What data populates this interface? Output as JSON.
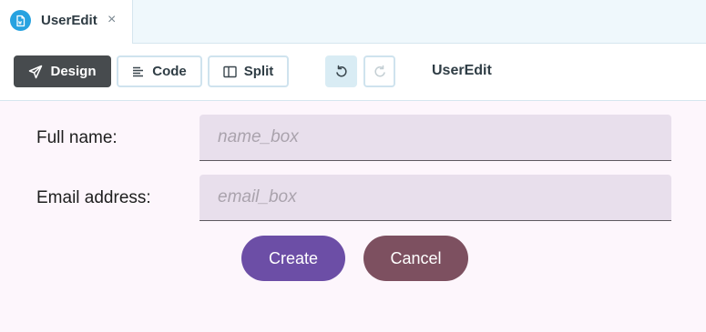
{
  "tab": {
    "title": "UserEdit",
    "close": "×"
  },
  "toolbar": {
    "design_label": "Design",
    "code_label": "Code",
    "split_label": "Split",
    "doc_title": "UserEdit",
    "icons": {
      "design": "paper-plane-icon",
      "code": "text-lines-icon",
      "split": "split-panel-icon",
      "undo": "undo-icon",
      "redo": "redo-icon"
    }
  },
  "form": {
    "name_label": "Full name:",
    "name_placeholder": "name_box",
    "email_label": "Email address:",
    "email_placeholder": "email_box",
    "create_label": "Create",
    "cancel_label": "Cancel"
  },
  "colors": {
    "primary": "#6c4ea6",
    "secondary": "#7d5060",
    "accent": "#27a2e0",
    "active_tool": "#474b4e"
  }
}
